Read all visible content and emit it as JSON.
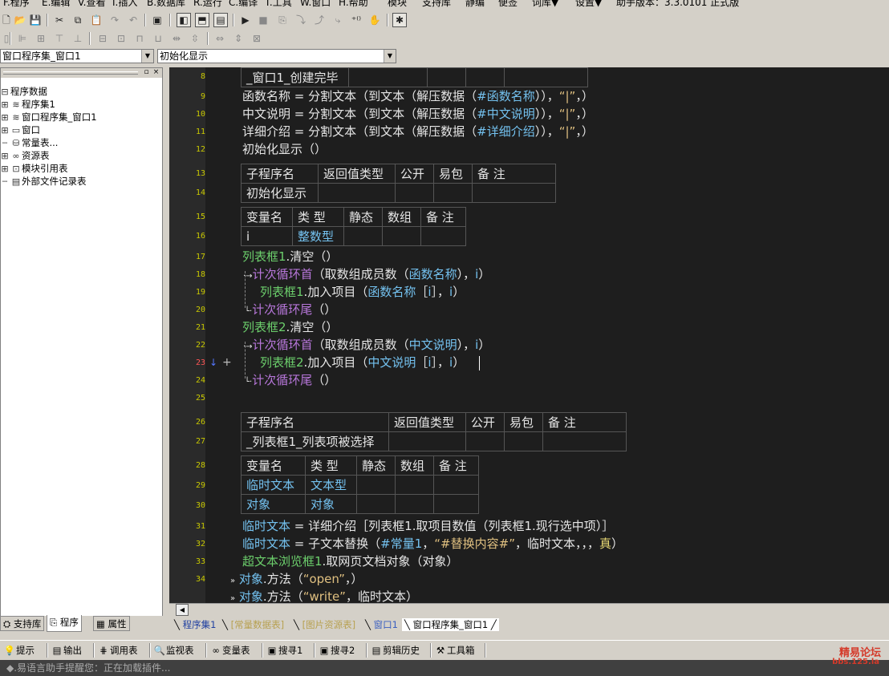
{
  "menu": {
    "items": [
      "F.程序",
      "E.编辑",
      "V.查看",
      "I.插入",
      "B.数据库",
      "R.运行",
      "C.编译",
      "T.工具",
      "W.窗口",
      "H.帮助",
      "模块",
      "支持库",
      "静编",
      "便签",
      "词库▼",
      "设置▼",
      "助手版本：3.3.0101 正式版"
    ]
  },
  "combos": {
    "assembly": "窗口程序集_窗口1",
    "subroutine": "初始化显示"
  },
  "left_panel": {
    "tree": [
      "程序数据",
      "程序集1",
      "窗口程序集_窗口1",
      "窗口",
      "常量表...",
      "资源表",
      "模块引用表",
      "外部文件记录表"
    ],
    "tabs": [
      "支持库",
      "程序",
      "属性"
    ]
  },
  "code": {
    "line_numbers": [
      "8",
      "9",
      "10",
      "11",
      "12",
      "13",
      "14",
      "15",
      "16",
      "17",
      "18",
      "19",
      "20",
      "21",
      "22",
      "23",
      "24",
      "25",
      "26",
      "27",
      "28",
      "29",
      "30",
      "31",
      "32",
      "33",
      "34"
    ],
    "line8": "_窗口1_创建完毕",
    "line9": {
      "a": "函数名称",
      "b": " = ",
      "c": "分割文本（到文本（解压数据（",
      "d": "#函数名称",
      "e": "）），",
      "f": "“|”",
      "g": "，）"
    },
    "line10": {
      "a": "中文说明",
      "b": " = ",
      "c": "分割文本（到文本（解压数据（",
      "d": "#中文说明",
      "e": "）），",
      "f": "“|”",
      "g": "，）"
    },
    "line11": {
      "a": "详细介绍",
      "b": " = ",
      "c": "分割文本（到文本（解压数据（",
      "d": "#详细介绍",
      "e": "）），",
      "f": "“|”",
      "g": "，）"
    },
    "line12": "初始化显示（）",
    "table1_headers": [
      "子程序名",
      "返回值类型",
      "公开",
      "易包",
      "备 注"
    ],
    "table1_row": "初始化显示",
    "table2_headers": [
      "变量名",
      "类 型",
      "静态",
      "数组",
      "备 注"
    ],
    "table2_row": [
      "i",
      "整数型"
    ],
    "line17": {
      "a": "列表框1",
      "b": ".清空（）"
    },
    "line18": {
      "a": "计次循环首",
      "b": "（取数组成员数（",
      "c": "函数名称",
      "d": "），",
      "e": "i",
      "f": "）"
    },
    "line19": {
      "a": "列表框1",
      "b": ".加入项目（",
      "c": "函数名称",
      "d": "［",
      "e": "i",
      "f": "］，",
      "g": "i",
      "h": "）"
    },
    "line20": {
      "a": "计次循环尾",
      "b": "（）"
    },
    "line21": {
      "a": "列表框2",
      "b": ".清空（）"
    },
    "line22": {
      "a": "计次循环首",
      "b": "（取数组成员数（",
      "c": "中文说明",
      "d": "），",
      "e": "i",
      "f": "）"
    },
    "line23": {
      "a": "列表框2",
      "b": ".加入项目（",
      "c": "中文说明",
      "d": "［",
      "e": "i",
      "f": "］，",
      "g": "i",
      "h": "）"
    },
    "line24": {
      "a": "计次循环尾",
      "b": "（）"
    },
    "table3_headers": [
      "子程序名",
      "返回值类型",
      "公开",
      "易包",
      "备 注"
    ],
    "table3_row": "_列表框1_列表项被选择",
    "table4_headers": [
      "变量名",
      "类 型",
      "静态",
      "数组",
      "备 注"
    ],
    "table4_rows": [
      [
        "临时文本",
        "文本型"
      ],
      [
        "对象",
        "对象"
      ]
    ],
    "line31": {
      "a": "临时文本",
      "b": " = ",
      "c": "详细介绍［",
      "d": "列表框1",
      "e": ".取项目数值（",
      "f": "列表框1",
      "g": ".现行选中项）］"
    },
    "line32": {
      "a": "临时文本",
      "b": " = ",
      "c": "子文本替换（",
      "d": "#常量1",
      "e": "，",
      "f": "“#替换内容#”",
      "g": "，",
      "h": "临时文本",
      "i": "，，，",
      "j": "真",
      "k": "）"
    },
    "line33": {
      "a": "超文本浏览框1",
      "b": ".取网页文档对象（",
      "c": "对象",
      "d": "）"
    },
    "line34": {
      "a": "对象",
      "b": ".方法（",
      "c": "“open”",
      "d": "，）"
    },
    "line35": {
      "a": "对象",
      "b": ".方法（",
      "c": "“write”",
      "d": "，",
      "e": "临时文本",
      "f": "）"
    }
  },
  "doc_tabs": [
    "程序集1",
    "[常量数据表]",
    "[图片资源表]",
    "窗口1",
    "窗口程序集_窗口1"
  ],
  "bottom_tabs": [
    "提示",
    "输出",
    "调用表",
    "监视表",
    "变量表",
    "搜寻1",
    "搜寻2",
    "剪辑历史",
    "工具箱"
  ],
  "status": "◆.易语言助手提醒您：正在加载插件...",
  "watermark": {
    "line1": "精易论坛",
    "line2": "bbs.125.la"
  },
  "colors": {
    "editor_bg": "#1e1e1e",
    "keyword_blue": "#74c2f0",
    "flow_purple": "#b877db",
    "object_green": "#6ccf6c",
    "string": "#e0c080"
  }
}
